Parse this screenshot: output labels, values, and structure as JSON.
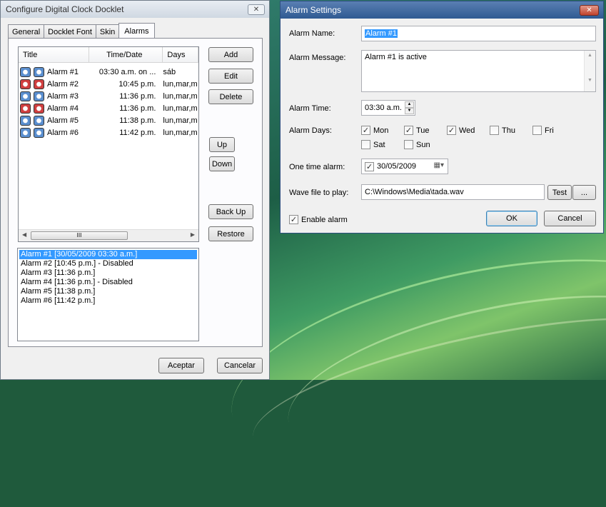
{
  "left_window": {
    "title": "Configure Digital Clock Docklet",
    "tabs": [
      "General",
      "Docklet Font",
      "Skin",
      "Alarms"
    ],
    "list": {
      "columns": [
        "Title",
        "Time/Date",
        "Days"
      ],
      "rows": [
        {
          "title": "Alarm #1",
          "time": "03:30 a.m. on ...",
          "days": "sáb",
          "enabled": true
        },
        {
          "title": "Alarm #2",
          "time": "10:45 p.m.",
          "days": "lun,mar,m",
          "enabled": false
        },
        {
          "title": "Alarm #3",
          "time": "11:36 p.m.",
          "days": "lun,mar,m",
          "enabled": true
        },
        {
          "title": "Alarm #4",
          "time": "11:36 p.m.",
          "days": "lun,mar,m",
          "enabled": false
        },
        {
          "title": "Alarm #5",
          "time": "11:38 p.m.",
          "days": "lun,mar,m",
          "enabled": true
        },
        {
          "title": "Alarm #6",
          "time": "11:42 p.m.",
          "days": "lun,mar,m",
          "enabled": true
        }
      ],
      "scroll_thumb": "III"
    },
    "buttons": {
      "add": "Add",
      "edit": "Edit",
      "delete": "Delete",
      "up": "Up",
      "down": "Down",
      "backup": "Back Up",
      "restore": "Restore",
      "accept": "Aceptar",
      "cancel": "Cancelar"
    },
    "summary": [
      "Alarm #1 [30/05/2009 03:30 a.m.]",
      "Alarm #2 [10:45 p.m.] - Disabled",
      "Alarm #3 [11:36 p.m.]",
      "Alarm #4 [11:36 p.m.] - Disabled",
      "Alarm #5 [11:38 p.m.]",
      "Alarm #6 [11:42 p.m.]"
    ]
  },
  "right_window": {
    "title": "Alarm Settings",
    "labels": {
      "name": "Alarm Name:",
      "message": "Alarm Message:",
      "time": "Alarm Time:",
      "days": "Alarm Days:",
      "one_time": "One time alarm:",
      "wave": "Wave file to play:",
      "enable": "Enable alarm"
    },
    "values": {
      "name": "Alarm #1",
      "message": "Alarm #1 is active",
      "time": "03:30 a.m.",
      "date": "30/05/2009",
      "wave": "C:\\Windows\\Media\\tada.wav"
    },
    "days": [
      {
        "label": "Mon",
        "checked": true
      },
      {
        "label": "Tue",
        "checked": true
      },
      {
        "label": "Wed",
        "checked": true
      },
      {
        "label": "Thu",
        "checked": false
      },
      {
        "label": "Fri",
        "checked": false
      },
      {
        "label": "Sat",
        "checked": false
      },
      {
        "label": "Sun",
        "checked": false
      }
    ],
    "buttons": {
      "test": "Test",
      "browse": "...",
      "ok": "OK",
      "cancel": "Cancel"
    }
  }
}
